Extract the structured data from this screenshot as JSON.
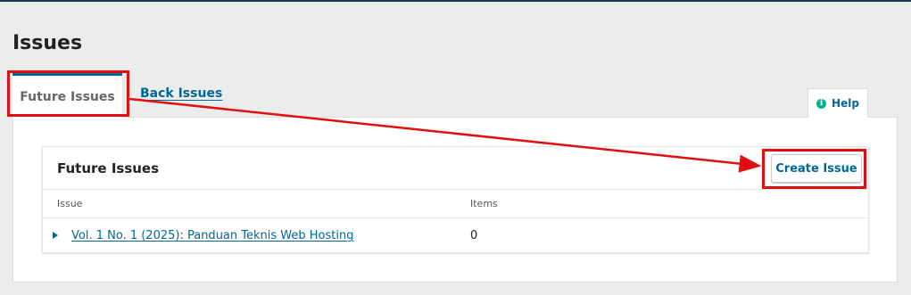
{
  "page": {
    "title": "Issues"
  },
  "tabs": [
    {
      "label": "Future Issues",
      "active": true
    },
    {
      "label": "Back Issues",
      "active": false
    }
  ],
  "help": {
    "label": "Help",
    "icon": "info-icon",
    "icon_glyph": "i"
  },
  "card": {
    "title": "Future Issues",
    "create_button_label": "Create Issue",
    "columns": {
      "issue": "Issue",
      "items": "Items"
    },
    "rows": [
      {
        "issue": "Vol. 1 No. 1 (2025): Panduan Teknis Web Hosting",
        "items": "0"
      }
    ]
  },
  "colors": {
    "accent": "#006798",
    "annotation": "#e01010",
    "help_icon": "#00b28d"
  }
}
